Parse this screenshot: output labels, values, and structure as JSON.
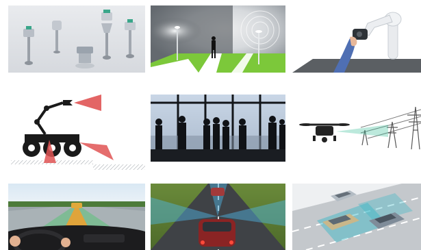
{
  "gallery": {
    "tiles": [
      {
        "id": "sensors",
        "icon": "radar-level-sensors-icon"
      },
      {
        "id": "street-lights",
        "icon": "motion-sensor-street-light-icon"
      },
      {
        "id": "cobot-arm",
        "icon": "collaborative-robot-arm-icon"
      },
      {
        "id": "mobile-robot",
        "icon": "mobile-robot-radar-icon"
      },
      {
        "id": "airport-silhouettes",
        "icon": "people-silhouettes-icon"
      },
      {
        "id": "drone-powerline",
        "icon": "drone-power-line-icon"
      },
      {
        "id": "driver-view",
        "icon": "car-interior-radar-icon"
      },
      {
        "id": "highway-night",
        "icon": "highway-radar-icon"
      },
      {
        "id": "traffic-3d",
        "icon": "traffic-radar-3d-icon"
      }
    ]
  }
}
